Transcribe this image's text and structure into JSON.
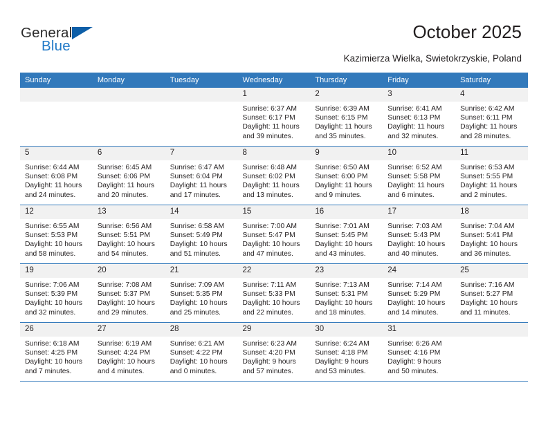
{
  "brand": {
    "name_part1": "General",
    "name_part2": "Blue",
    "accent_color": "#2079c7",
    "triangle_color": "#0e5fa8"
  },
  "header": {
    "title": "October 2025",
    "subtitle": "Kazimierza Wielka, Swietokrzyskie, Poland"
  },
  "calendar": {
    "header_bg": "#3279bb",
    "header_text_color": "#ffffff",
    "date_band_bg": "#f1f1f1",
    "weekdays": [
      "Sunday",
      "Monday",
      "Tuesday",
      "Wednesday",
      "Thursday",
      "Friday",
      "Saturday"
    ],
    "weeks": [
      [
        {
          "day": "",
          "empty": true,
          "sunrise": "",
          "sunset": "",
          "daylight": ""
        },
        {
          "day": "",
          "empty": true,
          "sunrise": "",
          "sunset": "",
          "daylight": ""
        },
        {
          "day": "",
          "empty": true,
          "sunrise": "",
          "sunset": "",
          "daylight": ""
        },
        {
          "day": "1",
          "empty": false,
          "sunrise": "Sunrise: 6:37 AM",
          "sunset": "Sunset: 6:17 PM",
          "daylight": "Daylight: 11 hours and 39 minutes."
        },
        {
          "day": "2",
          "empty": false,
          "sunrise": "Sunrise: 6:39 AM",
          "sunset": "Sunset: 6:15 PM",
          "daylight": "Daylight: 11 hours and 35 minutes."
        },
        {
          "day": "3",
          "empty": false,
          "sunrise": "Sunrise: 6:41 AM",
          "sunset": "Sunset: 6:13 PM",
          "daylight": "Daylight: 11 hours and 32 minutes."
        },
        {
          "day": "4",
          "empty": false,
          "sunrise": "Sunrise: 6:42 AM",
          "sunset": "Sunset: 6:11 PM",
          "daylight": "Daylight: 11 hours and 28 minutes."
        }
      ],
      [
        {
          "day": "5",
          "empty": false,
          "sunrise": "Sunrise: 6:44 AM",
          "sunset": "Sunset: 6:08 PM",
          "daylight": "Daylight: 11 hours and 24 minutes."
        },
        {
          "day": "6",
          "empty": false,
          "sunrise": "Sunrise: 6:45 AM",
          "sunset": "Sunset: 6:06 PM",
          "daylight": "Daylight: 11 hours and 20 minutes."
        },
        {
          "day": "7",
          "empty": false,
          "sunrise": "Sunrise: 6:47 AM",
          "sunset": "Sunset: 6:04 PM",
          "daylight": "Daylight: 11 hours and 17 minutes."
        },
        {
          "day": "8",
          "empty": false,
          "sunrise": "Sunrise: 6:48 AM",
          "sunset": "Sunset: 6:02 PM",
          "daylight": "Daylight: 11 hours and 13 minutes."
        },
        {
          "day": "9",
          "empty": false,
          "sunrise": "Sunrise: 6:50 AM",
          "sunset": "Sunset: 6:00 PM",
          "daylight": "Daylight: 11 hours and 9 minutes."
        },
        {
          "day": "10",
          "empty": false,
          "sunrise": "Sunrise: 6:52 AM",
          "sunset": "Sunset: 5:58 PM",
          "daylight": "Daylight: 11 hours and 6 minutes."
        },
        {
          "day": "11",
          "empty": false,
          "sunrise": "Sunrise: 6:53 AM",
          "sunset": "Sunset: 5:55 PM",
          "daylight": "Daylight: 11 hours and 2 minutes."
        }
      ],
      [
        {
          "day": "12",
          "empty": false,
          "sunrise": "Sunrise: 6:55 AM",
          "sunset": "Sunset: 5:53 PM",
          "daylight": "Daylight: 10 hours and 58 minutes."
        },
        {
          "day": "13",
          "empty": false,
          "sunrise": "Sunrise: 6:56 AM",
          "sunset": "Sunset: 5:51 PM",
          "daylight": "Daylight: 10 hours and 54 minutes."
        },
        {
          "day": "14",
          "empty": false,
          "sunrise": "Sunrise: 6:58 AM",
          "sunset": "Sunset: 5:49 PM",
          "daylight": "Daylight: 10 hours and 51 minutes."
        },
        {
          "day": "15",
          "empty": false,
          "sunrise": "Sunrise: 7:00 AM",
          "sunset": "Sunset: 5:47 PM",
          "daylight": "Daylight: 10 hours and 47 minutes."
        },
        {
          "day": "16",
          "empty": false,
          "sunrise": "Sunrise: 7:01 AM",
          "sunset": "Sunset: 5:45 PM",
          "daylight": "Daylight: 10 hours and 43 minutes."
        },
        {
          "day": "17",
          "empty": false,
          "sunrise": "Sunrise: 7:03 AM",
          "sunset": "Sunset: 5:43 PM",
          "daylight": "Daylight: 10 hours and 40 minutes."
        },
        {
          "day": "18",
          "empty": false,
          "sunrise": "Sunrise: 7:04 AM",
          "sunset": "Sunset: 5:41 PM",
          "daylight": "Daylight: 10 hours and 36 minutes."
        }
      ],
      [
        {
          "day": "19",
          "empty": false,
          "sunrise": "Sunrise: 7:06 AM",
          "sunset": "Sunset: 5:39 PM",
          "daylight": "Daylight: 10 hours and 32 minutes."
        },
        {
          "day": "20",
          "empty": false,
          "sunrise": "Sunrise: 7:08 AM",
          "sunset": "Sunset: 5:37 PM",
          "daylight": "Daylight: 10 hours and 29 minutes."
        },
        {
          "day": "21",
          "empty": false,
          "sunrise": "Sunrise: 7:09 AM",
          "sunset": "Sunset: 5:35 PM",
          "daylight": "Daylight: 10 hours and 25 minutes."
        },
        {
          "day": "22",
          "empty": false,
          "sunrise": "Sunrise: 7:11 AM",
          "sunset": "Sunset: 5:33 PM",
          "daylight": "Daylight: 10 hours and 22 minutes."
        },
        {
          "day": "23",
          "empty": false,
          "sunrise": "Sunrise: 7:13 AM",
          "sunset": "Sunset: 5:31 PM",
          "daylight": "Daylight: 10 hours and 18 minutes."
        },
        {
          "day": "24",
          "empty": false,
          "sunrise": "Sunrise: 7:14 AM",
          "sunset": "Sunset: 5:29 PM",
          "daylight": "Daylight: 10 hours and 14 minutes."
        },
        {
          "day": "25",
          "empty": false,
          "sunrise": "Sunrise: 7:16 AM",
          "sunset": "Sunset: 5:27 PM",
          "daylight": "Daylight: 10 hours and 11 minutes."
        }
      ],
      [
        {
          "day": "26",
          "empty": false,
          "sunrise": "Sunrise: 6:18 AM",
          "sunset": "Sunset: 4:25 PM",
          "daylight": "Daylight: 10 hours and 7 minutes."
        },
        {
          "day": "27",
          "empty": false,
          "sunrise": "Sunrise: 6:19 AM",
          "sunset": "Sunset: 4:24 PM",
          "daylight": "Daylight: 10 hours and 4 minutes."
        },
        {
          "day": "28",
          "empty": false,
          "sunrise": "Sunrise: 6:21 AM",
          "sunset": "Sunset: 4:22 PM",
          "daylight": "Daylight: 10 hours and 0 minutes."
        },
        {
          "day": "29",
          "empty": false,
          "sunrise": "Sunrise: 6:23 AM",
          "sunset": "Sunset: 4:20 PM",
          "daylight": "Daylight: 9 hours and 57 minutes."
        },
        {
          "day": "30",
          "empty": false,
          "sunrise": "Sunrise: 6:24 AM",
          "sunset": "Sunset: 4:18 PM",
          "daylight": "Daylight: 9 hours and 53 minutes."
        },
        {
          "day": "31",
          "empty": false,
          "sunrise": "Sunrise: 6:26 AM",
          "sunset": "Sunset: 4:16 PM",
          "daylight": "Daylight: 9 hours and 50 minutes."
        },
        {
          "day": "",
          "empty": true,
          "sunrise": "",
          "sunset": "",
          "daylight": ""
        }
      ]
    ]
  }
}
